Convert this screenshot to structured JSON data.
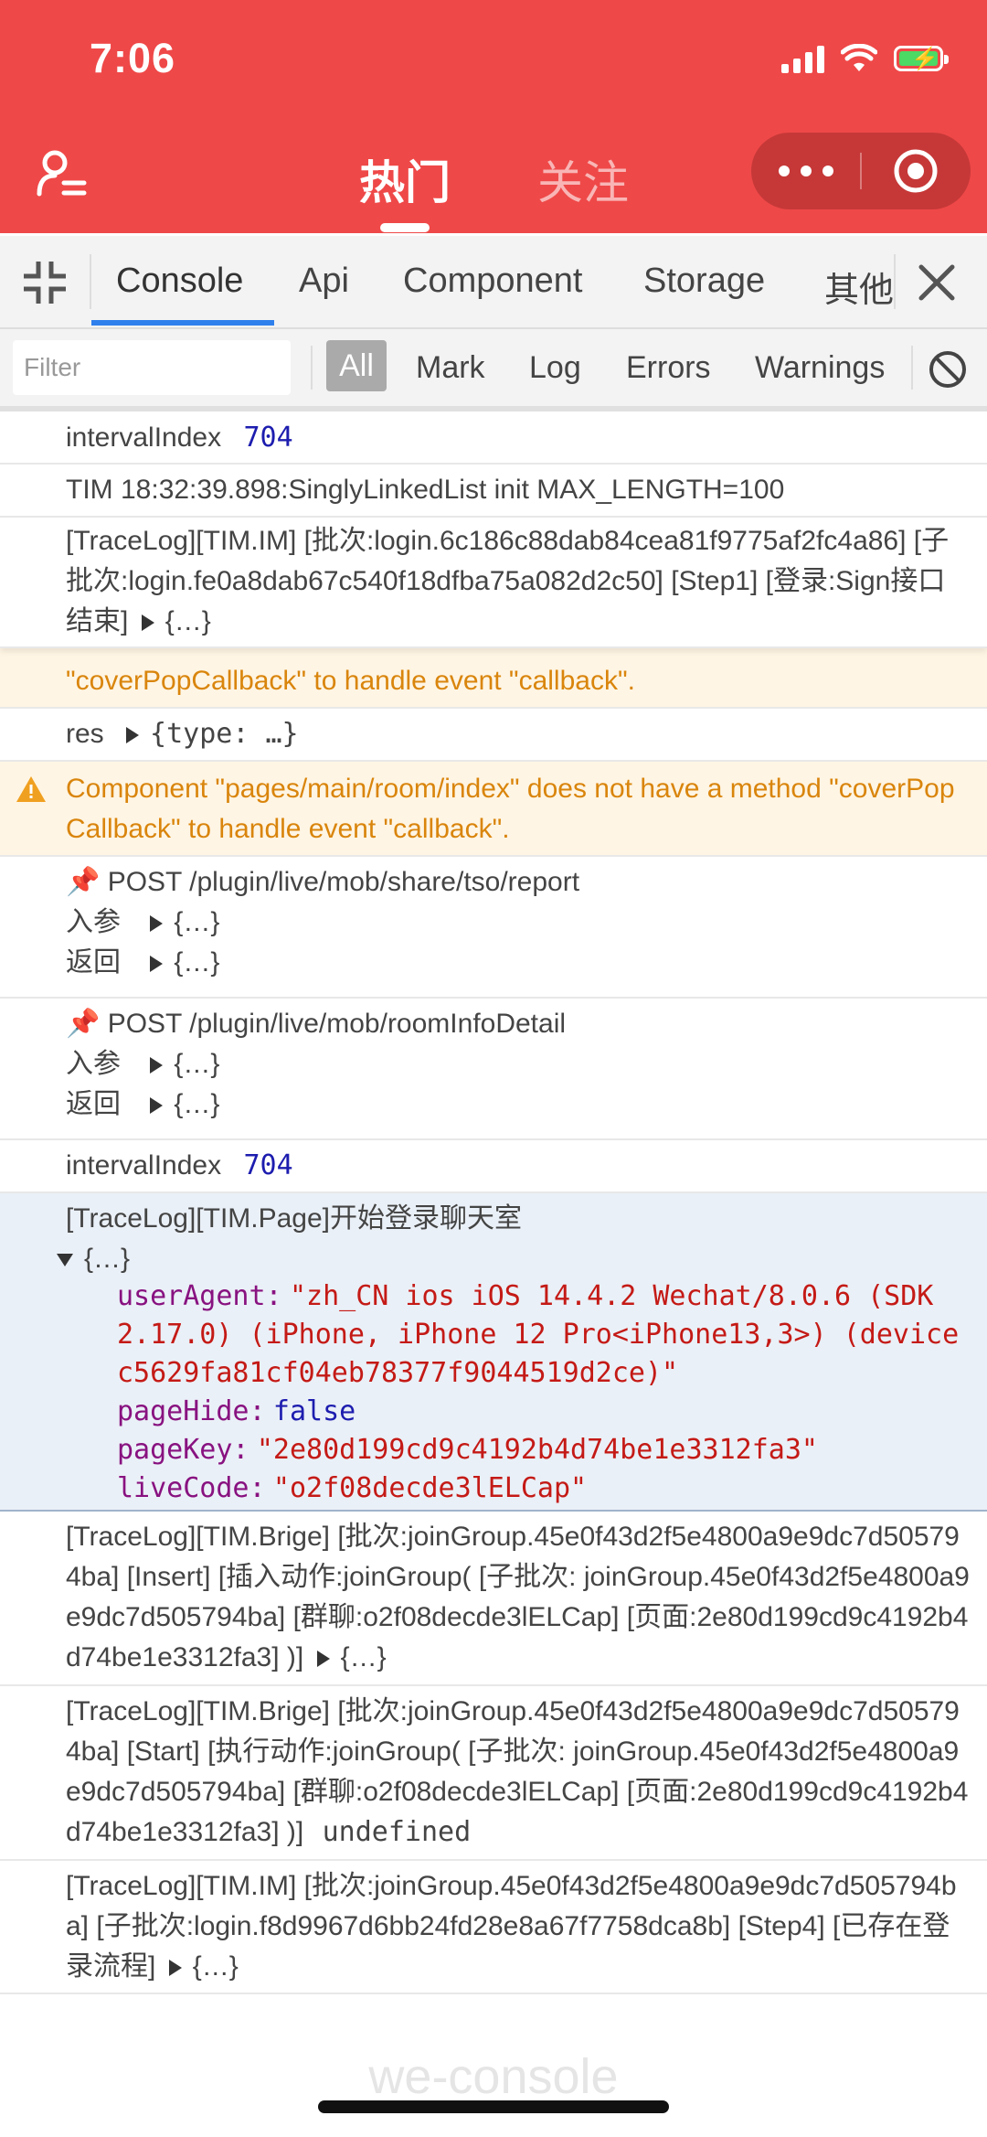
{
  "status_bar": {
    "time": "7:06"
  },
  "app_bar": {
    "tab_hot": "热门",
    "tab_follow": "关注",
    "brand_color": "#ef4848"
  },
  "devtools": {
    "tabs": [
      "Console",
      "Api",
      "Component",
      "Storage",
      "其他"
    ],
    "active_tab": "Console",
    "filter_placeholder": "Filter",
    "levels": [
      "All",
      "Mark",
      "Log",
      "Errors",
      "Warnings"
    ],
    "active_level": "All"
  },
  "logs": {
    "e1_label": "intervalIndex",
    "e1_value": "704",
    "e2_text": "TIM 18:32:39.898:SinglyLinkedList init MAX_LENGTH=100",
    "e3_text": "[TraceLog][TIM.IM] [批次:login.6c186c88dab84cea81f9775af2fc4a86] [子批次:login.fe0a8dab67c540f18dfba75a082d2c50] [Step1] [登录:Sign接口结束]",
    "e3_obj": "{…}",
    "e4_text": "\"coverPopCallback\" to handle event \"callback\".",
    "e5_label": "res",
    "e5_obj": "{type: …}",
    "e6_text": "Component \"pages/main/room/index\" does not have a method \"coverPopCallback\" to handle event \"callback\".",
    "e7_title": "📌 POST /plugin/live/mob/share/tso/report",
    "e7_in_label": "入参",
    "e7_in_obj": "{…}",
    "e7_out_label": "返回",
    "e7_out_obj": "{…}",
    "e8_title": "📌 POST /plugin/live/mob/roomInfoDetail",
    "e8_in_label": "入参",
    "e8_in_obj": "{…}",
    "e8_out_label": "返回",
    "e8_out_obj": "{…}",
    "e9_label": "intervalIndex",
    "e9_value": "704",
    "e10_title": "[TraceLog][TIM.Page]开始登录聊天室",
    "e10_obj": "{…}",
    "e10_k1": "userAgent:",
    "e10_v1": "\"zh_CN ios iOS 14.4.2 Wechat/8.0.6 (SDK 2.17.0) (iPhone, iPhone 12 Pro<iPhone13,3>) (device c5629fa81cf04eb78377f9044519d2ce)\"",
    "e10_k2": "pageHide:",
    "e10_v2": "false",
    "e10_k3": "pageKey:",
    "e10_v3": "\"2e80d199cd9c4192b4d74be1e3312fa3\"",
    "e10_k4": "liveCode:",
    "e10_v4": "\"o2f08decde3lELCap\"",
    "e11_text": "[TraceLog][TIM.Brige] [批次:joinGroup.45e0f43d2f5e4800a9e9dc7d505794ba] [Insert] [插入动作:joinGroup( [子批次: joinGroup.45e0f43d2f5e4800a9e9dc7d505794ba] [群聊:o2f08decde3lELCap] [页面:2e80d199cd9c4192b4d74be1e3312fa3] )]",
    "e11_obj": "{…}",
    "e12_text": "[TraceLog][TIM.Brige] [批次:joinGroup.45e0f43d2f5e4800a9e9dc7d505794ba] [Start] [执行动作:joinGroup( [子批次: joinGroup.45e0f43d2f5e4800a9e9dc7d505794ba] [群聊:o2f08decde3lELCap] [页面:2e80d199cd9c4192b4d74be1e3312fa3] )]",
    "e12_val": "undefined",
    "e13_text": "[TraceLog][TIM.IM] [批次:joinGroup.45e0f43d2f5e4800a9e9dc7d505794ba] [子批次:login.f8d9967d6bb24fd28e8a67f7758dca8b] [Step4] [已存在登录流程]",
    "e13_obj": "{…}"
  },
  "watermark": "we-console",
  "icons": [
    "user-list-icon",
    "more-dots-icon",
    "target-close-icon",
    "shrink-icon",
    "close-icon",
    "clear-console-icon",
    "warning-icon",
    "expand-triangle-icon"
  ]
}
